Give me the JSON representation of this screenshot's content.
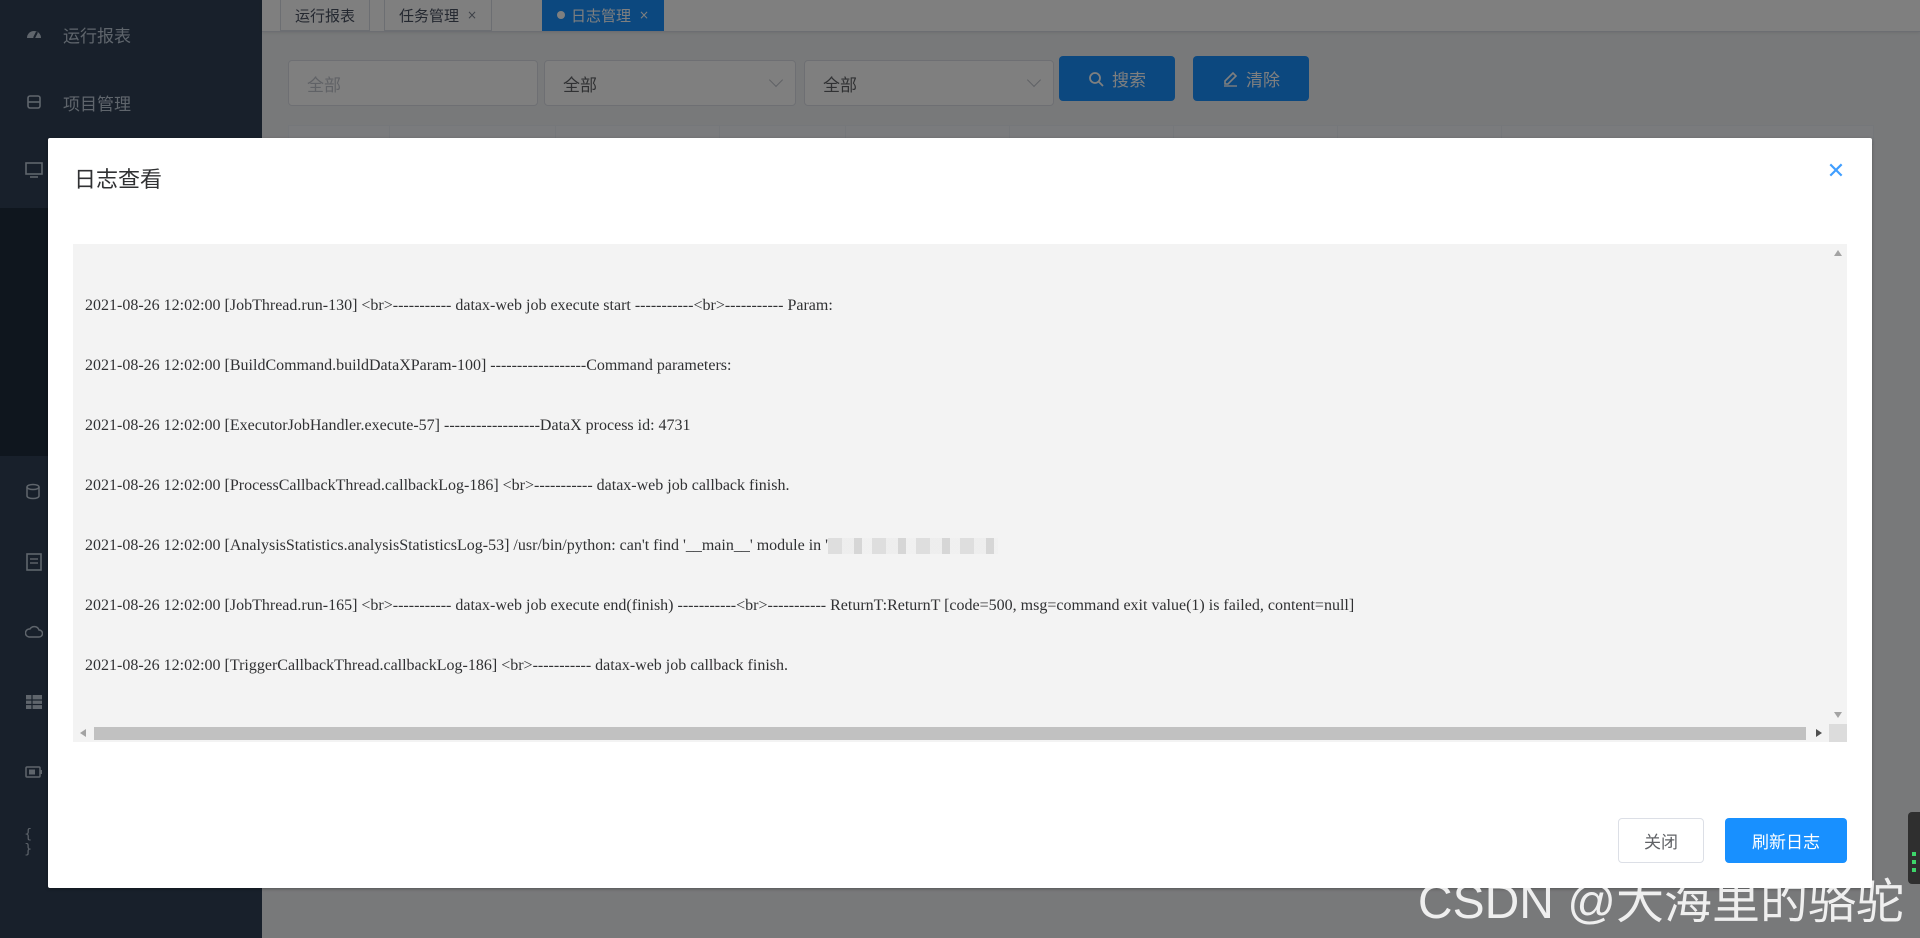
{
  "sidebar": {
    "items": [
      {
        "label": "运行报表",
        "icon": "dashboard-icon"
      },
      {
        "label": "项目管理",
        "icon": "database-icon"
      }
    ],
    "collapsed_icons": [
      "monitor-icon",
      "datasource-icon",
      "document-icon",
      "cloud-icon",
      "table-icon",
      "battery-icon",
      "braces-icon"
    ],
    "braces_glyph": "{ }"
  },
  "tabs": [
    {
      "label": "运行报表",
      "closable": false,
      "active": false
    },
    {
      "label": "任务管理",
      "closable": true,
      "active": false
    },
    {
      "label": "日志管理",
      "closable": true,
      "active": true
    }
  ],
  "tab_close_glyph": "×",
  "filters": {
    "input_placeholder": "全部",
    "select1_value": "全部",
    "select2_value": "全部",
    "search_label": "搜索",
    "clear_label": "清除"
  },
  "dialog": {
    "title": "日志查看",
    "close_glyph": "✕",
    "log_lines": [
      "2021-08-26 12:02:00 [JobThread.run-130] <br>----------- datax-web job execute start -----------<br>----------- Param:",
      "2021-08-26 12:02:00 [BuildCommand.buildDataXParam-100] ------------------Command parameters:",
      "2021-08-26 12:02:00 [ExecutorJobHandler.execute-57] ------------------DataX process id: 4731",
      "2021-08-26 12:02:00 [ProcessCallbackThread.callbackLog-186] <br>----------- datax-web job callback finish.",
      "2021-08-26 12:02:00 [AnalysisStatistics.analysisStatisticsLog-53] /usr/bin/python: can't find '__main__' module in '",
      "2021-08-26 12:02:00 [JobThread.run-165] <br>----------- datax-web job execute end(finish) -----------<br>----------- ReturnT:ReturnT [code=500, msg=command exit value(1) is failed, content=null]",
      "2021-08-26 12:02:00 [TriggerCallbackThread.callbackLog-186] <br>----------- datax-web job callback finish."
    ],
    "close_button": "关闭",
    "refresh_button": "刷新日志"
  },
  "watermark": "CSDN @大海里的骆驼",
  "colors": {
    "primary": "#1890ff",
    "sidebar_bg": "#304156",
    "log_bg": "#f3f3f3"
  }
}
